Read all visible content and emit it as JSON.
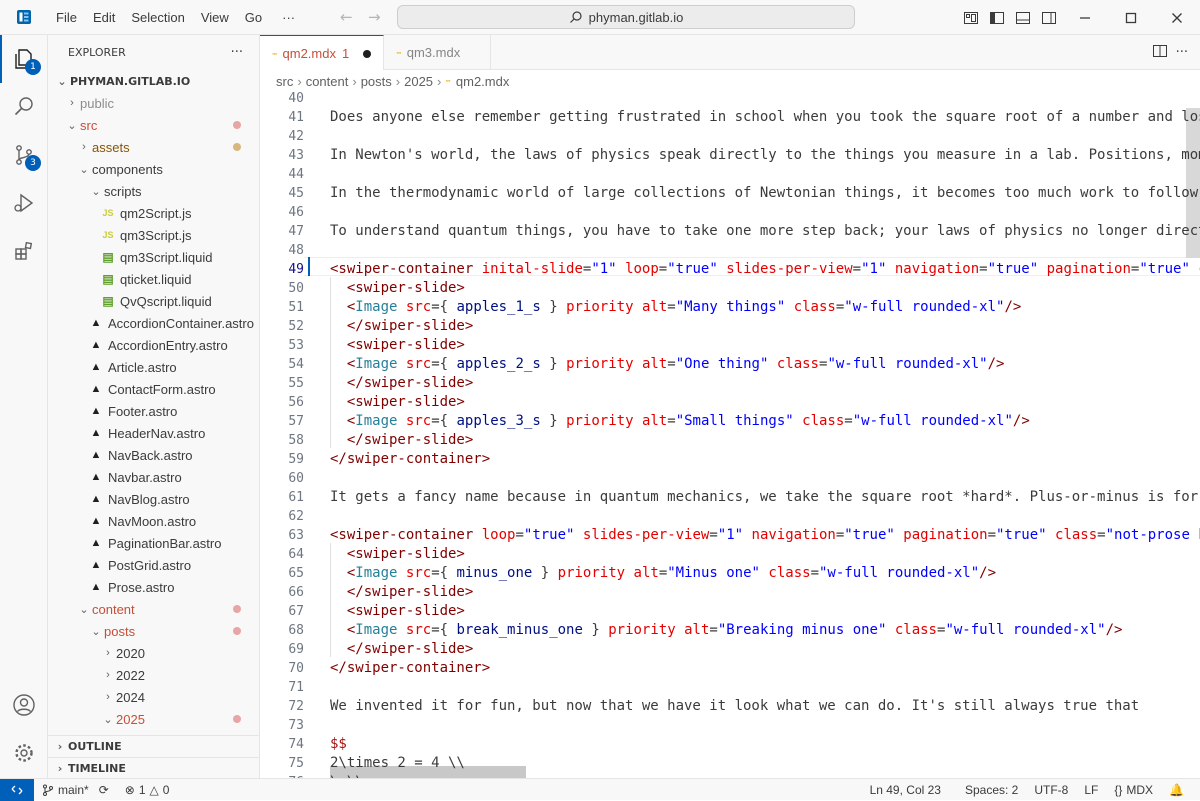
{
  "title_bar": {
    "menu": [
      "File",
      "Edit",
      "Selection",
      "View",
      "Go"
    ],
    "more": "···",
    "command_center": "phyman.gitlab.io"
  },
  "activity_bar": {
    "explorer_badge": "1",
    "scm_badge": "3"
  },
  "sidebar": {
    "header": "EXPLORER",
    "more": "···",
    "root": "PHYMAN.GITLAB.IO",
    "tree": [
      {
        "label": "public",
        "depth": 1,
        "kind": "folder",
        "open": false,
        "color": "#8c8c8c"
      },
      {
        "label": "src",
        "depth": 1,
        "kind": "folder",
        "open": true,
        "color": "#c74e39",
        "dot": "#e8a5a5"
      },
      {
        "label": "assets",
        "depth": 2,
        "kind": "folder",
        "open": false,
        "color": "#895503",
        "dot": "#d8b77e"
      },
      {
        "label": "components",
        "depth": 2,
        "kind": "folder",
        "open": true,
        "color": "#3b3b3b"
      },
      {
        "label": "scripts",
        "depth": 3,
        "kind": "folder",
        "open": true,
        "color": "#3b3b3b"
      },
      {
        "label": "qm2Script.js",
        "depth": 4,
        "kind": "js",
        "color": "#3b3b3b"
      },
      {
        "label": "qm3Script.js",
        "depth": 4,
        "kind": "js",
        "color": "#3b3b3b"
      },
      {
        "label": "qm3Script.liquid",
        "depth": 4,
        "kind": "liquid",
        "color": "#3b3b3b"
      },
      {
        "label": "qticket.liquid",
        "depth": 4,
        "kind": "liquid",
        "color": "#3b3b3b"
      },
      {
        "label": "QvQscript.liquid",
        "depth": 4,
        "kind": "liquid",
        "color": "#3b3b3b"
      },
      {
        "label": "AccordionContainer.astro",
        "depth": 3,
        "kind": "astro",
        "color": "#3b3b3b"
      },
      {
        "label": "AccordionEntry.astro",
        "depth": 3,
        "kind": "astro",
        "color": "#3b3b3b"
      },
      {
        "label": "Article.astro",
        "depth": 3,
        "kind": "astro",
        "color": "#3b3b3b"
      },
      {
        "label": "ContactForm.astro",
        "depth": 3,
        "kind": "astro",
        "color": "#3b3b3b"
      },
      {
        "label": "Footer.astro",
        "depth": 3,
        "kind": "astro",
        "color": "#3b3b3b"
      },
      {
        "label": "HeaderNav.astro",
        "depth": 3,
        "kind": "astro",
        "color": "#3b3b3b"
      },
      {
        "label": "NavBack.astro",
        "depth": 3,
        "kind": "astro",
        "color": "#3b3b3b"
      },
      {
        "label": "Navbar.astro",
        "depth": 3,
        "kind": "astro",
        "color": "#3b3b3b"
      },
      {
        "label": "NavBlog.astro",
        "depth": 3,
        "kind": "astro",
        "color": "#3b3b3b"
      },
      {
        "label": "NavMoon.astro",
        "depth": 3,
        "kind": "astro",
        "color": "#3b3b3b"
      },
      {
        "label": "PaginationBar.astro",
        "depth": 3,
        "kind": "astro",
        "color": "#3b3b3b"
      },
      {
        "label": "PostGrid.astro",
        "depth": 3,
        "kind": "astro",
        "color": "#3b3b3b"
      },
      {
        "label": "Prose.astro",
        "depth": 3,
        "kind": "astro",
        "color": "#3b3b3b"
      },
      {
        "label": "content",
        "depth": 2,
        "kind": "folder",
        "open": true,
        "color": "#c74e39",
        "dot": "#e8a5a5"
      },
      {
        "label": "posts",
        "depth": 3,
        "kind": "folder",
        "open": true,
        "color": "#c74e39",
        "dot": "#e8a5a5"
      },
      {
        "label": "2020",
        "depth": 4,
        "kind": "folder",
        "open": false,
        "color": "#3b3b3b"
      },
      {
        "label": "2022",
        "depth": 4,
        "kind": "folder",
        "open": false,
        "color": "#3b3b3b"
      },
      {
        "label": "2024",
        "depth": 4,
        "kind": "folder",
        "open": false,
        "color": "#3b3b3b"
      },
      {
        "label": "2025",
        "depth": 4,
        "kind": "folder",
        "open": true,
        "color": "#c74e39",
        "dot": "#e8a5a5"
      }
    ],
    "outline": "OUTLINE",
    "timeline": "TIMELINE"
  },
  "tabs": [
    {
      "label": "qm2.mdx",
      "suffix": "1",
      "modified": true,
      "active": true
    },
    {
      "label": "qm3.mdx",
      "active": false
    }
  ],
  "breadcrumb": [
    "src",
    "content",
    "posts",
    "2025",
    "qm2.mdx"
  ],
  "editor": {
    "current_line": 49,
    "lines": [
      {
        "n": 40,
        "s": []
      },
      {
        "n": 41,
        "s": [
          [
            "p",
            "Does anyone else remember getting frustrated in school when you took the square root of a number and lost"
          ]
        ]
      },
      {
        "n": 42,
        "s": []
      },
      {
        "n": 43,
        "s": [
          [
            "p",
            "In Newton's world, the laws of physics speak directly to the things you measure in a lab. Positions, momen"
          ]
        ]
      },
      {
        "n": 44,
        "s": []
      },
      {
        "n": 45,
        "s": [
          [
            "p",
            "In the thermodynamic world of large collections of Newtonian things, it becomes too much work to follow ea"
          ]
        ]
      },
      {
        "n": 46,
        "s": []
      },
      {
        "n": 47,
        "s": [
          [
            "p",
            "To understand quantum things, you have to take one more step back; your laws of physics no longer directly"
          ]
        ]
      },
      {
        "n": 48,
        "s": []
      },
      {
        "n": 49,
        "s": [
          [
            "tg",
            "<swiper-container"
          ],
          [
            "p",
            " "
          ],
          [
            "at",
            "inital-slide"
          ],
          [
            "p",
            "="
          ],
          [
            "vl",
            "\"1\""
          ],
          [
            "p",
            " "
          ],
          [
            "at",
            "loop"
          ],
          [
            "p",
            "="
          ],
          [
            "vl",
            "\"true\""
          ],
          [
            "p",
            " "
          ],
          [
            "at",
            "slides-per-view"
          ],
          [
            "p",
            "="
          ],
          [
            "vl",
            "\"1\""
          ],
          [
            "p",
            " "
          ],
          [
            "at",
            "navigation"
          ],
          [
            "p",
            "="
          ],
          [
            "vl",
            "\"true\""
          ],
          [
            "p",
            " "
          ],
          [
            "at",
            "pagination"
          ],
          [
            "p",
            "="
          ],
          [
            "vl",
            "\"true\""
          ],
          [
            "p",
            " "
          ],
          [
            "at",
            "cl"
          ]
        ]
      },
      {
        "n": 50,
        "s": [
          [
            "p",
            "  "
          ],
          [
            "tg",
            "<swiper-slide>"
          ]
        ]
      },
      {
        "n": 51,
        "s": [
          [
            "p",
            "  "
          ],
          [
            "tg",
            "<"
          ],
          [
            "cm",
            "Image"
          ],
          [
            "p",
            " "
          ],
          [
            "at",
            "src"
          ],
          [
            "p",
            "={ "
          ],
          [
            "vr",
            "apples_1_s"
          ],
          [
            "p",
            " } "
          ],
          [
            "at",
            "priority"
          ],
          [
            "p",
            " "
          ],
          [
            "at",
            "alt"
          ],
          [
            "p",
            "="
          ],
          [
            "vl",
            "\"Many things\""
          ],
          [
            "p",
            " "
          ],
          [
            "at",
            "class"
          ],
          [
            "p",
            "="
          ],
          [
            "vl",
            "\"w-full rounded-xl\""
          ],
          [
            "tg",
            "/>"
          ]
        ]
      },
      {
        "n": 52,
        "s": [
          [
            "p",
            "  "
          ],
          [
            "tg",
            "</swiper-slide>"
          ]
        ]
      },
      {
        "n": 53,
        "s": [
          [
            "p",
            "  "
          ],
          [
            "tg",
            "<swiper-slide>"
          ]
        ]
      },
      {
        "n": 54,
        "s": [
          [
            "p",
            "  "
          ],
          [
            "tg",
            "<"
          ],
          [
            "cm",
            "Image"
          ],
          [
            "p",
            " "
          ],
          [
            "at",
            "src"
          ],
          [
            "p",
            "={ "
          ],
          [
            "vr",
            "apples_2_s"
          ],
          [
            "p",
            " } "
          ],
          [
            "at",
            "priority"
          ],
          [
            "p",
            " "
          ],
          [
            "at",
            "alt"
          ],
          [
            "p",
            "="
          ],
          [
            "vl",
            "\"One thing\""
          ],
          [
            "p",
            " "
          ],
          [
            "at",
            "class"
          ],
          [
            "p",
            "="
          ],
          [
            "vl",
            "\"w-full rounded-xl\""
          ],
          [
            "tg",
            "/>"
          ]
        ]
      },
      {
        "n": 55,
        "s": [
          [
            "p",
            "  "
          ],
          [
            "tg",
            "</swiper-slide>"
          ]
        ]
      },
      {
        "n": 56,
        "s": [
          [
            "p",
            "  "
          ],
          [
            "tg",
            "<swiper-slide>"
          ]
        ]
      },
      {
        "n": 57,
        "s": [
          [
            "p",
            "  "
          ],
          [
            "tg",
            "<"
          ],
          [
            "cm",
            "Image"
          ],
          [
            "p",
            " "
          ],
          [
            "at",
            "src"
          ],
          [
            "p",
            "={ "
          ],
          [
            "vr",
            "apples_3_s"
          ],
          [
            "p",
            " } "
          ],
          [
            "at",
            "priority"
          ],
          [
            "p",
            " "
          ],
          [
            "at",
            "alt"
          ],
          [
            "p",
            "="
          ],
          [
            "vl",
            "\"Small things\""
          ],
          [
            "p",
            " "
          ],
          [
            "at",
            "class"
          ],
          [
            "p",
            "="
          ],
          [
            "vl",
            "\"w-full rounded-xl\""
          ],
          [
            "tg",
            "/>"
          ]
        ]
      },
      {
        "n": 58,
        "s": [
          [
            "p",
            "  "
          ],
          [
            "tg",
            "</swiper-slide>"
          ]
        ]
      },
      {
        "n": 59,
        "s": [
          [
            "tg",
            "</swiper-container>"
          ]
        ]
      },
      {
        "n": 60,
        "s": []
      },
      {
        "n": 61,
        "s": [
          [
            "p",
            "It gets a fancy name because in quantum mechanics, we take the square root *hard*. Plus-or-minus is for wi"
          ]
        ]
      },
      {
        "n": 62,
        "s": []
      },
      {
        "n": 63,
        "s": [
          [
            "tg",
            "<swiper-container"
          ],
          [
            "p",
            " "
          ],
          [
            "at",
            "loop"
          ],
          [
            "p",
            "="
          ],
          [
            "vl",
            "\"true\""
          ],
          [
            "p",
            " "
          ],
          [
            "at",
            "slides-per-view"
          ],
          [
            "p",
            "="
          ],
          [
            "vl",
            "\"1\""
          ],
          [
            "p",
            " "
          ],
          [
            "at",
            "navigation"
          ],
          [
            "p",
            "="
          ],
          [
            "vl",
            "\"true\""
          ],
          [
            "p",
            " "
          ],
          [
            "at",
            "pagination"
          ],
          [
            "p",
            "="
          ],
          [
            "vl",
            "\"true\""
          ],
          [
            "p",
            " "
          ],
          [
            "at",
            "class"
          ],
          [
            "p",
            "="
          ],
          [
            "vl",
            "\"not-prose bg"
          ]
        ]
      },
      {
        "n": 64,
        "s": [
          [
            "p",
            "  "
          ],
          [
            "tg",
            "<swiper-slide>"
          ]
        ]
      },
      {
        "n": 65,
        "s": [
          [
            "p",
            "  "
          ],
          [
            "tg",
            "<"
          ],
          [
            "cm",
            "Image"
          ],
          [
            "p",
            " "
          ],
          [
            "at",
            "src"
          ],
          [
            "p",
            "={ "
          ],
          [
            "vr",
            "minus_one"
          ],
          [
            "p",
            " } "
          ],
          [
            "at",
            "priority"
          ],
          [
            "p",
            " "
          ],
          [
            "at",
            "alt"
          ],
          [
            "p",
            "="
          ],
          [
            "vl",
            "\"Minus one\""
          ],
          [
            "p",
            " "
          ],
          [
            "at",
            "class"
          ],
          [
            "p",
            "="
          ],
          [
            "vl",
            "\"w-full rounded-xl\""
          ],
          [
            "tg",
            "/>"
          ]
        ]
      },
      {
        "n": 66,
        "s": [
          [
            "p",
            "  "
          ],
          [
            "tg",
            "</swiper-slide>"
          ]
        ]
      },
      {
        "n": 67,
        "s": [
          [
            "p",
            "  "
          ],
          [
            "tg",
            "<swiper-slide>"
          ]
        ]
      },
      {
        "n": 68,
        "s": [
          [
            "p",
            "  "
          ],
          [
            "tg",
            "<"
          ],
          [
            "cm",
            "Image"
          ],
          [
            "p",
            " "
          ],
          [
            "at",
            "src"
          ],
          [
            "p",
            "={ "
          ],
          [
            "vr",
            "break_minus_one"
          ],
          [
            "p",
            " } "
          ],
          [
            "at",
            "priority"
          ],
          [
            "p",
            " "
          ],
          [
            "at",
            "alt"
          ],
          [
            "p",
            "="
          ],
          [
            "vl",
            "\"Breaking minus one\""
          ],
          [
            "p",
            " "
          ],
          [
            "at",
            "class"
          ],
          [
            "p",
            "="
          ],
          [
            "vl",
            "\"w-full rounded-xl\""
          ],
          [
            "tg",
            "/>"
          ]
        ]
      },
      {
        "n": 69,
        "s": [
          [
            "p",
            "  "
          ],
          [
            "tg",
            "</swiper-slide>"
          ]
        ]
      },
      {
        "n": 70,
        "s": [
          [
            "tg",
            "</swiper-container>"
          ]
        ]
      },
      {
        "n": 71,
        "s": []
      },
      {
        "n": 72,
        "s": [
          [
            "p",
            "We invented it for fun, but now that we have it look what we can do. It's still always true that"
          ]
        ]
      },
      {
        "n": 73,
        "s": []
      },
      {
        "n": 74,
        "s": [
          [
            "ma",
            "$$"
          ]
        ]
      },
      {
        "n": 75,
        "s": [
          [
            "p",
            "2\\times 2 = 4 \\\\"
          ]
        ]
      },
      {
        "n": 76,
        "s": [
          [
            "p",
            "\\ \\\\"
          ]
        ]
      }
    ]
  },
  "status_bar": {
    "branch": "main*",
    "errors": "1",
    "warnings": "0",
    "position": "Ln 49, Col 23",
    "spaces": "Spaces: 2",
    "encoding": "UTF-8",
    "eol": "LF",
    "language": "MDX"
  },
  "colors": {
    "accent": "#005fb8",
    "error_dot": "#e8a5a5",
    "modified_dot": "#d8b77e",
    "tag": "#800000",
    "attribute": "#e50000",
    "string": "#0000ff"
  }
}
